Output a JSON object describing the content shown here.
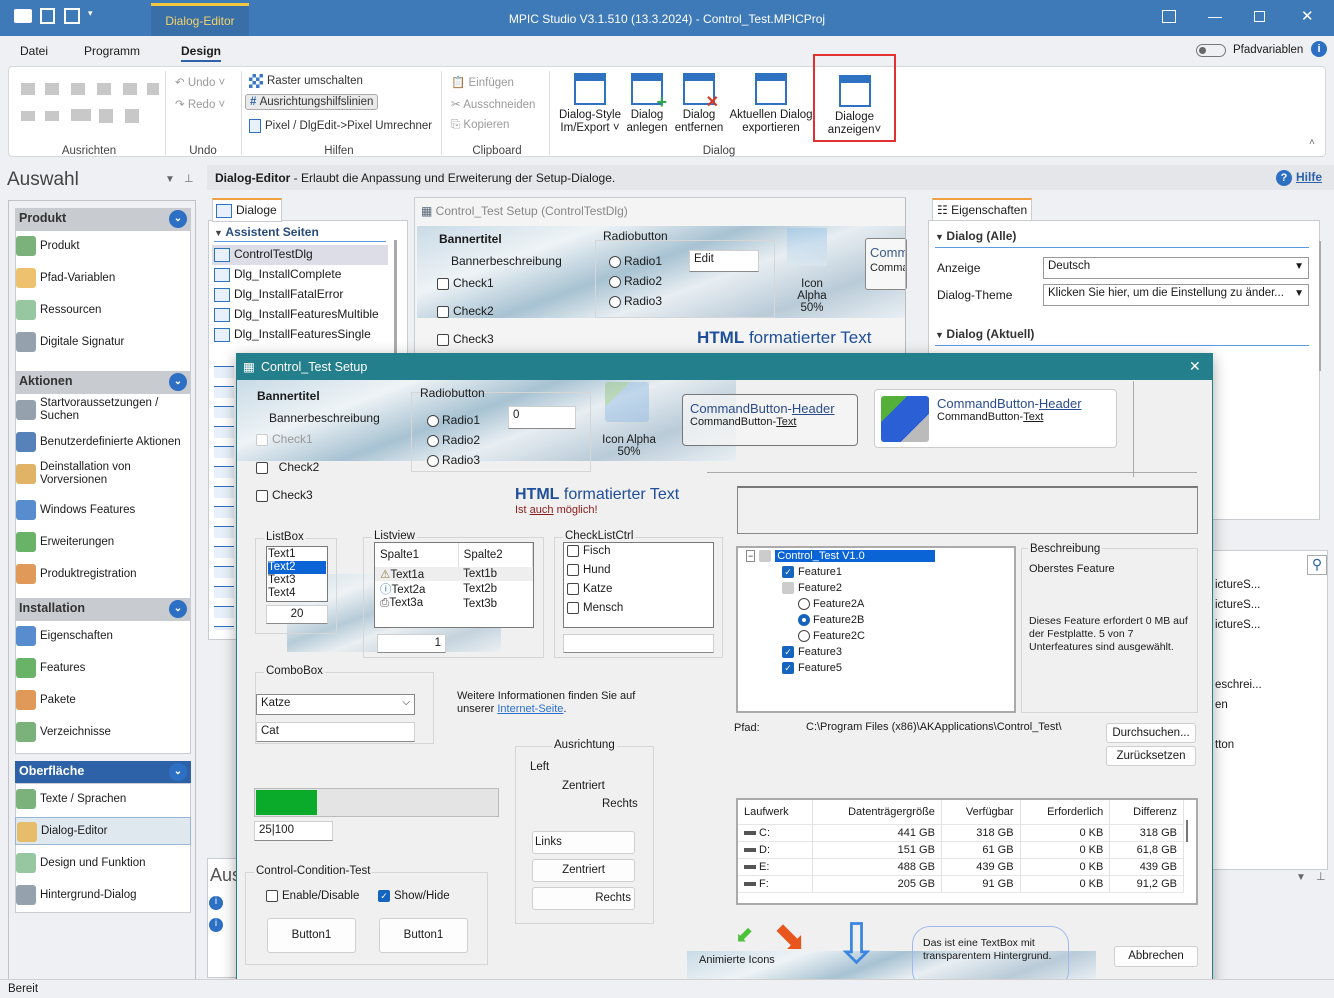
{
  "titlebar": {
    "title": "MPIC Studio V3.1.510 (13.3.2024) - Control_Test.MPICProj",
    "context_tab": "Dialog-Editor"
  },
  "menu": {
    "items": [
      "Datei",
      "Programm",
      "Design"
    ],
    "active": "Design",
    "pfadvariablen_label": "Pfadvariablen",
    "pfadvariablen_on": false
  },
  "ribbon": {
    "groups": {
      "ausrichten": "Ausrichten",
      "undo": "Undo",
      "hilfen": "Hilfen",
      "clipboard": "Clipboard",
      "dialog": "Dialog"
    },
    "undo": "Undo",
    "redo": "Redo",
    "raster": "Raster umschalten",
    "hilfslinien": "Ausrichtungshilfslinien",
    "umrechner": "Pixel / DlgEdit->Pixel Umrechner",
    "einfuegen": "Einfügen",
    "ausschneiden": "Ausschneiden",
    "kopieren": "Kopieren",
    "style_1": "Dialog-Style",
    "style_2": "Im/Export",
    "anlegen_1": "Dialog",
    "anlegen_2": "anlegen",
    "entfernen_1": "Dialog",
    "entfernen_2": "entfernen",
    "export_1": "Aktuellen Dialog",
    "export_2": "exportieren",
    "anzeigen_1": "Dialoge",
    "anzeigen_2": "anzeigen",
    "highlight_color": "#e03030"
  },
  "sidebar": {
    "title": "Auswahl",
    "sections": [
      {
        "title": "Produkt",
        "items": [
          "Produkt",
          "Pfad-Variablen",
          "Ressourcen",
          "Digitale Signatur"
        ]
      },
      {
        "title": "Aktionen",
        "items": [
          "Startvoraussetzungen / Suchen",
          "Benutzerdefinierte Aktionen",
          "Deinstallation von Vorversionen",
          "Windows Features",
          "Erweiterungen",
          "Produktregistration"
        ]
      },
      {
        "title": "Installation",
        "items": [
          "Eigenschaften",
          "Features",
          "Pakete",
          "Verzeichnisse"
        ]
      },
      {
        "title": "Oberfläche",
        "items": [
          "Texte / Sprachen",
          "Dialog-Editor",
          "Design und Funktion",
          "Hintergrund-Dialog"
        ],
        "selected": "Dialog-Editor"
      }
    ]
  },
  "infobar": {
    "title": "Dialog-Editor",
    "text": " - Erlaubt die Anpassung und Erweiterung der Setup-Dialoge.",
    "help": "Hilfe"
  },
  "dialoge_panel": {
    "tab": "Dialoge",
    "group": "Assistent Seiten",
    "items": [
      "ControlTestDlg",
      "Dlg_InstallComplete",
      "Dlg_InstallFatalError",
      "Dlg_InstallFeaturesMultible",
      "Dlg_InstallFeaturesSingle"
    ],
    "selected": "ControlTestDlg"
  },
  "preview": {
    "title": "Control_Test Setup  (ControlTestDlg)",
    "bannertitel": "Bannertitel",
    "bannerbeschreibung": "Bannerbeschreibung",
    "checks": [
      "Check1",
      "Check2",
      "Check3"
    ],
    "radio_group": "Radiobutton",
    "radios": [
      "Radio1",
      "Radio2",
      "Radio3"
    ],
    "edit": "Edit",
    "icon_alpha": "Icon Alpha",
    "icon_alpha_pct": "50%",
    "cmd_partial_1": "Comm",
    "cmd_partial_2": "Comma",
    "html_bold": "HTML",
    "html_rest": " formatierter Text"
  },
  "eigenschaften": {
    "tab": "Eigenschaften",
    "group1": "Dialog (Alle)",
    "anzeige_label": "Anzeige",
    "anzeige_value": "Deutsch",
    "theme_label": "Dialog-Theme",
    "theme_value": "Klicken Sie hier, um die Einstellung zu änder...",
    "group2": "Dialog (Aktuell)"
  },
  "right_partial": {
    "items": [
      "ictureS...",
      "ictureS...",
      "ictureS...",
      "eschrei...",
      "en",
      "tton"
    ]
  },
  "bottom_left": {
    "title": "Aus"
  },
  "dialog": {
    "title": "Control_Test Setup",
    "bannertitel": "Bannertitel",
    "bannerbeschreibung": "Bannerbeschreibung",
    "check1": "Check1",
    "check2": "Check2",
    "check3": "Check3",
    "radio_group": "Radiobutton",
    "radios": [
      "Radio1",
      "Radio2",
      "Radio3"
    ],
    "edit_value": "0",
    "icon_alpha": "Icon Alpha",
    "icon_alpha_pct": "50%",
    "cmd1_header_a": "CommandButton-",
    "cmd1_header_b": "Header",
    "cmd1_text_a": "CommandButton-",
    "cmd1_text_b": "Text",
    "cmd2_header_a": "CommandButton-",
    "cmd2_header_b": "Header",
    "cmd2_text_a": "CommandButton-",
    "cmd2_text_b": "Text",
    "html_bold": "HTML",
    "html_rest": " formatierter Text",
    "html_sub_a": "Ist ",
    "html_sub_b": "auch",
    "html_sub_c": " möglich!",
    "listbox": {
      "label": "ListBox",
      "items": [
        "Text1",
        "Text2",
        "Text3",
        "Text4"
      ],
      "selected": "Text2",
      "spin": "20"
    },
    "listview": {
      "label": "Listview",
      "columns": [
        "Spalte1",
        "Spalte2"
      ],
      "rows": [
        [
          "Text1a",
          "Text1b"
        ],
        [
          "Text2a",
          "Text2b"
        ],
        [
          "Text3a",
          "Text3b"
        ]
      ],
      "row_icons": [
        "warning-icon",
        "info-icon",
        "printer-icon"
      ],
      "spin": "1"
    },
    "checklist": {
      "label": "CheckListCtrl",
      "items": [
        "Fisch",
        "Hund",
        "Katze",
        "Mensch"
      ]
    },
    "tree": {
      "root": "Control_Test V1.0",
      "items": [
        {
          "label": "Feature1",
          "type": "check",
          "checked": true,
          "level": 1
        },
        {
          "label": "Feature2",
          "type": "check",
          "checked": "partial",
          "level": 1
        },
        {
          "label": "Feature2A",
          "type": "radio",
          "checked": false,
          "level": 2
        },
        {
          "label": "Feature2B",
          "type": "radio",
          "checked": true,
          "level": 2
        },
        {
          "label": "Feature2C",
          "type": "radio",
          "checked": false,
          "level": 2
        },
        {
          "label": "Feature3",
          "type": "check",
          "checked": true,
          "level": 1
        },
        {
          "label": "Feature5",
          "type": "check",
          "checked": true,
          "level": 1
        }
      ]
    },
    "beschreibung": {
      "label": "Beschreibung",
      "title": "Oberstes Feature",
      "text": "Dieses Feature erfordert 0 MB auf der Festplatte. 5 von 7 Unterfeatures sind ausgewählt."
    },
    "pfad_label": "Pfad:",
    "pfad_value": "C:\\Program Files (x86)\\AKApplications\\Control_Test\\",
    "durchsuchen": "Durchsuchen...",
    "zuruecksetzen": "Zurücksetzen",
    "combobox": {
      "label": "ComboBox",
      "selected": "Katze",
      "text": "Cat"
    },
    "info_a": "Weitere Informationen finden Sie auf",
    "info_b": "unserer ",
    "info_link": "Internet-Seite",
    "info_c": ".",
    "progress": {
      "value": 25,
      "max": 100,
      "text": "25|100",
      "color": "#0aaa2a"
    },
    "ausrichtung": {
      "label": "Ausrichtung",
      "left": "Left",
      "center": "Zentriert",
      "right": "Rechts",
      "btn_links": "Links",
      "btn_zentriert": "Zentriert",
      "btn_rechts": "Rechts"
    },
    "condition": {
      "label": "Control-Condition-Test",
      "enable": "Enable/Disable",
      "enable_checked": false,
      "show": "Show/Hide",
      "show_checked": true,
      "button1": "Button1",
      "button2": "Button1"
    },
    "drives": {
      "columns": [
        "Laufwerk",
        "Datenträgergröße",
        "Verfügbar",
        "Erforderlich",
        "Differenz"
      ],
      "rows": [
        [
          "C:",
          "441 GB",
          "318 GB",
          "0 KB",
          "318 GB"
        ],
        [
          "D:",
          "151 GB",
          "61 GB",
          "0 KB",
          "61,8 GB"
        ],
        [
          "E:",
          "488 GB",
          "439 GB",
          "0 KB",
          "439 GB"
        ],
        [
          "F:",
          "205 GB",
          "91 GB",
          "0 KB",
          "91,2 GB"
        ]
      ]
    },
    "animated": "Animierte Icons",
    "textbox": "Das ist eine TextBox mit transparentem Hintergrund.",
    "abbrechen": "Abbrechen"
  },
  "statusbar": {
    "text": "Bereit"
  }
}
